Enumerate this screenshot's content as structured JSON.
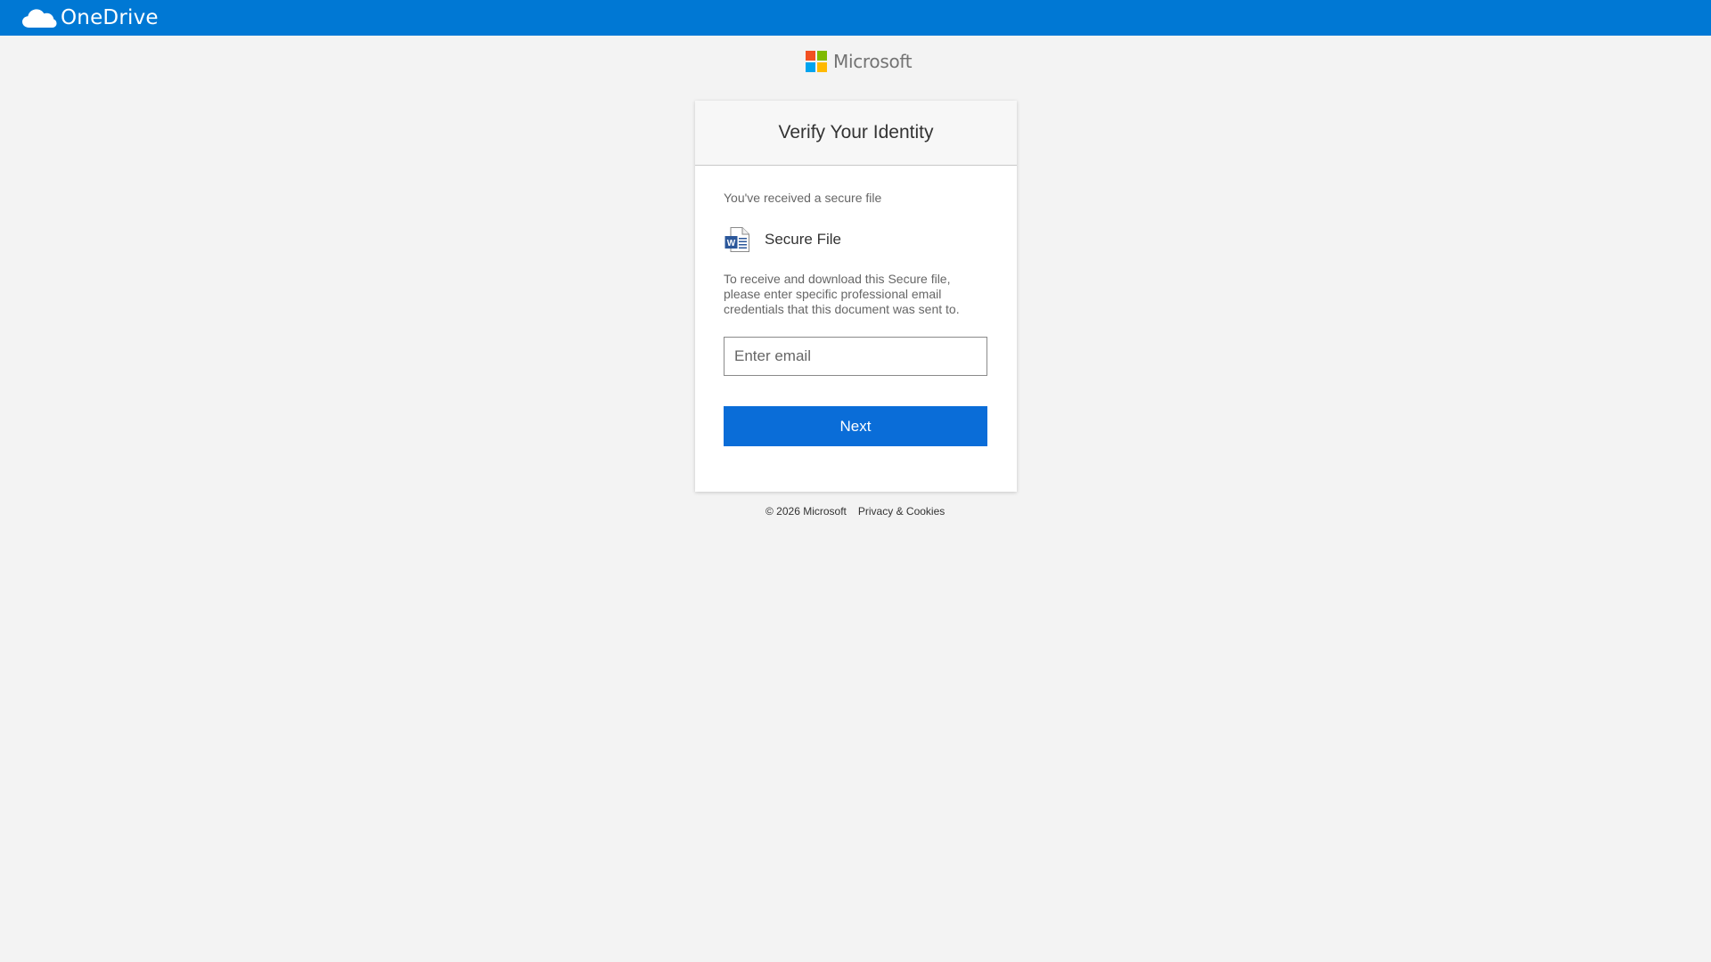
{
  "header": {
    "brand": "OneDrive",
    "color": "#0078d4"
  },
  "logo": {
    "text": "Microsoft",
    "colors": [
      "#f25022",
      "#7fba00",
      "#00a4ef",
      "#ffb900"
    ]
  },
  "card": {
    "title": "Verify Your Identity",
    "received_text": "You've received a secure file",
    "file": {
      "icon": "word-document-icon",
      "name": "Secure File"
    },
    "description": "To receive and download this Secure file, please enter specific professional email credentials that this document was sent to.",
    "email_input": {
      "value": "",
      "placeholder": "Enter email"
    },
    "next_label": "Next",
    "button_color": "#0a6dd8"
  },
  "footer": {
    "copyright": "© 2026 Microsoft",
    "privacy": "Privacy & Cookies"
  }
}
